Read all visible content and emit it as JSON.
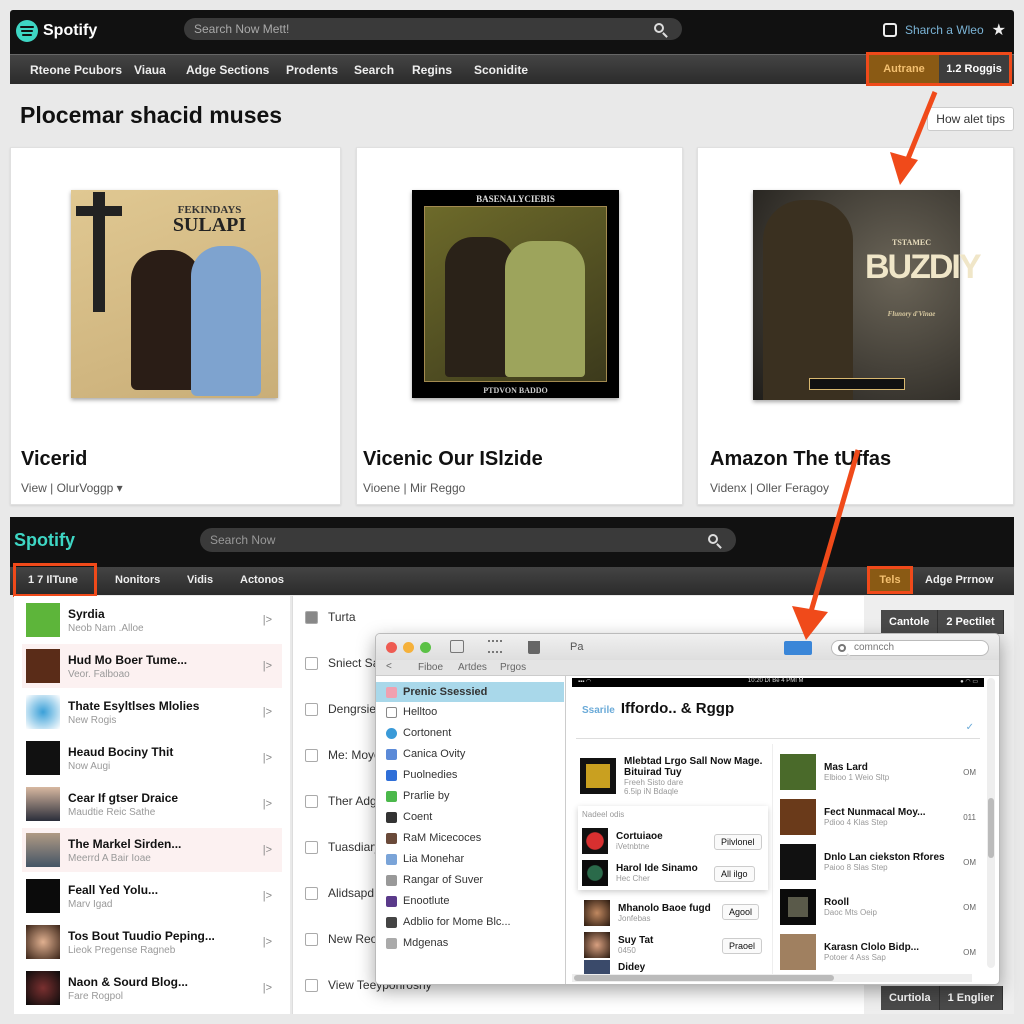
{
  "top": {
    "brand": "Spotify",
    "search_placeholder": "Search Now Mett!",
    "right_link": "Sharch a Wleo",
    "nav": [
      "Rteone Pcubors",
      "Viaua",
      "Adge Sections",
      "Prodents",
      "Search",
      "Regins",
      "Sconidite"
    ],
    "highlight_tabs": [
      "Autrane",
      "1.2 Roggis"
    ],
    "heading": "Plocemar shacid muses",
    "tips_button": "How alet tips"
  },
  "cards": [
    {
      "title": "Vicerid",
      "sub_a": "View",
      "sub_b": "OlurVoggp",
      "art_top": "FEKINDAYS",
      "art_main": "SULAPI"
    },
    {
      "title": "Vicenic Our ISlzide",
      "sub_a": "Vioene",
      "sub_b": "Mir Reggo",
      "art_top": "BASENALYCIEBIS",
      "art_main": "",
      "art_bottom": "PTDVON BADDO"
    },
    {
      "title": "Amazon The tUffas",
      "sub_a": "Videnx",
      "sub_b": "Oller Feragoy",
      "art_top": "TSTAMEC",
      "art_main": "BUZDIY",
      "art_bottom": "Flunory d'Vinae"
    }
  ],
  "lower": {
    "brand": "Spotify",
    "search_placeholder": "Search Now",
    "nav": [
      "1 7 IlTune",
      "Nonitors",
      "Vidis",
      "Actonos"
    ],
    "nav_right": [
      "Tels",
      "Adge Prrnow"
    ],
    "list": [
      {
        "title": "Syrdia",
        "sub": "Neob Nam .Alloe"
      },
      {
        "title": "Hud Mo Boer Tume...",
        "sub": "Veor. Falboao"
      },
      {
        "title": "Thate Esyltlses Mlolies",
        "sub": "New Rogis"
      },
      {
        "title": "Heaud Bociny Thit",
        "sub": "Now Augi"
      },
      {
        "title": "Cear If gtser Draice",
        "sub": "Maudtie Reic Sathe"
      },
      {
        "title": "The Markel Sirden...",
        "sub": "Meerrd A Bair Ioae"
      },
      {
        "title": "Feall Yed Yolu...",
        "sub": "Marv Igad"
      },
      {
        "title": "Tos Bout Tuudio Peping...",
        "sub": "Lieok Pregense Ragneb"
      },
      {
        "title": "Naon & Sourd Blog...",
        "sub": "Fare Rogpol"
      }
    ],
    "checks": [
      "Turta",
      "Sniect Sar",
      "Dengrsies",
      "Me: Moyo",
      "Ther Adgr",
      "Tuasdiary",
      "Alidsapd",
      "New Reop",
      "View Teeyponrosny"
    ],
    "right_tabs_top": [
      "Cantole",
      "2 Pectilet"
    ],
    "right_tabs_bottom": [
      "Curtiola",
      "1 Englier"
    ]
  },
  "mac": {
    "toolbar_label": "Pa",
    "sub_nav": [
      "Fiboe",
      "Artdes",
      "Prgos"
    ],
    "search_placeholder": "comncch",
    "sidebar": [
      "Prenic Ssessied",
      "Helltoo",
      "Cortonent",
      "Canica Ovity",
      "Puolnedies",
      "Prarlie by",
      "Coent",
      "RaM Micecoces",
      "Lia Monehar",
      "Rangar of Suver",
      "Enootlute",
      "Adblio for Mome Blc...",
      "Mdgenas"
    ],
    "phone_status_center": "10:20 DI Be 4 PMI M",
    "phone_title_accent": "Ssarile",
    "phone_title": "Iffordo..  & Rggp",
    "featured": {
      "title": "Mlebtad Lrgo Sall Now Mage.",
      "sub": "Bituirad Tuy",
      "meta1": "Freeh Sisto dare",
      "meta2": "6.5ip iN Bdaqle"
    },
    "section_label": "Nadeel odis",
    "left_rows": [
      {
        "title": "Cortuiaoe",
        "sub": "iVetnbtne",
        "btn": "Pilvlonel"
      },
      {
        "title": "Harol Ide Sinamo",
        "sub": "Hec Cher",
        "btn": "All ilgo"
      },
      {
        "title": "Mhanolo Baoe fugd",
        "sub": "Jonfebas",
        "btn": "Agool"
      },
      {
        "title": "Suy Tat",
        "sub": "0450",
        "btn": "Praoel"
      },
      {
        "title": "Didey",
        "sub": "",
        "btn": ""
      }
    ],
    "right_rows": [
      {
        "title": "Mas Lard",
        "sub": "Elbioo 1 Weio Sltp",
        "val": "OM"
      },
      {
        "title": "Fect Nunmacal Moy...",
        "sub": "Pdioo 4 Klas Step",
        "val": "011"
      },
      {
        "title": "Dnlo Lan ciekston Rfores",
        "sub": "Paioo 8 Slas Step",
        "val": "OM"
      },
      {
        "title": "Rooll",
        "sub": "Daoc Mts Oeip",
        "val": "OM"
      },
      {
        "title": "Karasn Clolo Bidp...",
        "sub": "Potoer 4 Ass Sap",
        "val": "OM"
      }
    ]
  },
  "colors": {
    "accent_orange": "#f04a1a",
    "brand_teal": "#3ed6c4",
    "spotify_green": "#5db53a"
  }
}
